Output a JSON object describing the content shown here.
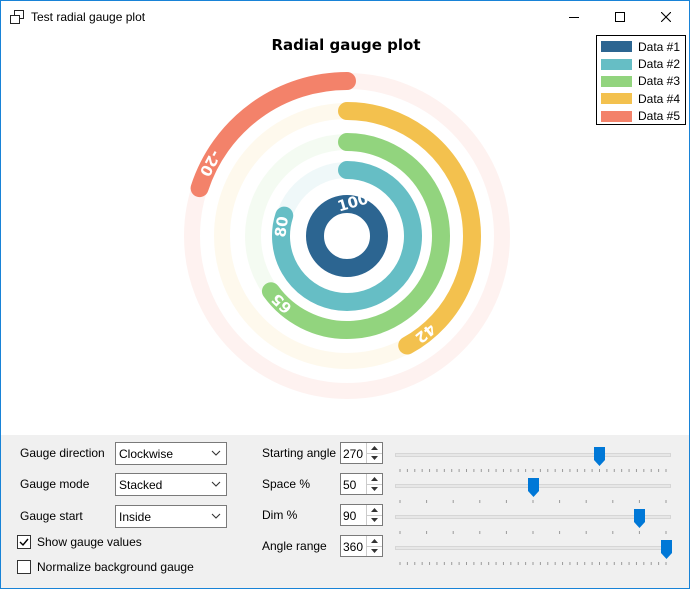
{
  "window": {
    "title": "Test radial gauge plot"
  },
  "plot": {
    "title": "Radial gauge plot",
    "legend": [
      {
        "label": "Data #1",
        "color": "#2c6591"
      },
      {
        "label": "Data #2",
        "color": "#66bec5"
      },
      {
        "label": "Data #3",
        "color": "#92d47e"
      },
      {
        "label": "Data #4",
        "color": "#f3c14e"
      },
      {
        "label": "Data #5",
        "color": "#f3826a"
      }
    ]
  },
  "chart_data": {
    "type": "radial-gauge",
    "title": "Radial gauge plot",
    "gauge_direction": "Clockwise",
    "gauge_mode": "Stacked",
    "starting_angle_deg": 270,
    "angle_range_deg": 360,
    "series": [
      {
        "name": "Data #1",
        "value": 100,
        "value_label": "100",
        "color": "#2c6591"
      },
      {
        "name": "Data #2",
        "value": 80,
        "value_label": "80",
        "color": "#66bec5"
      },
      {
        "name": "Data #3",
        "value": 65,
        "value_label": "65",
        "color": "#92d47e"
      },
      {
        "name": "Data #4",
        "value": 42,
        "value_label": "42",
        "color": "#f3c14e"
      },
      {
        "name": "Data #5",
        "value": -20,
        "value_label": "-20",
        "color": "#f3826a"
      }
    ]
  },
  "controls": {
    "gauge_direction": {
      "label": "Gauge direction",
      "value": "Clockwise"
    },
    "gauge_mode": {
      "label": "Gauge mode",
      "value": "Stacked"
    },
    "gauge_start": {
      "label": "Gauge start",
      "value": "Inside"
    },
    "show_values": {
      "label": "Show gauge values",
      "checked": true
    },
    "normalize_background": {
      "label": "Normalize background gauge",
      "checked": false
    },
    "starting_angle": {
      "label": "Starting angle",
      "value": "270",
      "slider_fraction": 0.75
    },
    "space": {
      "label": "Space %",
      "value": "50",
      "slider_fraction": 0.5
    },
    "dim": {
      "label": "Dim %",
      "value": "90",
      "slider_fraction": 0.9
    },
    "angle_range": {
      "label": "Angle range",
      "value": "360",
      "slider_fraction": 1.0
    }
  }
}
